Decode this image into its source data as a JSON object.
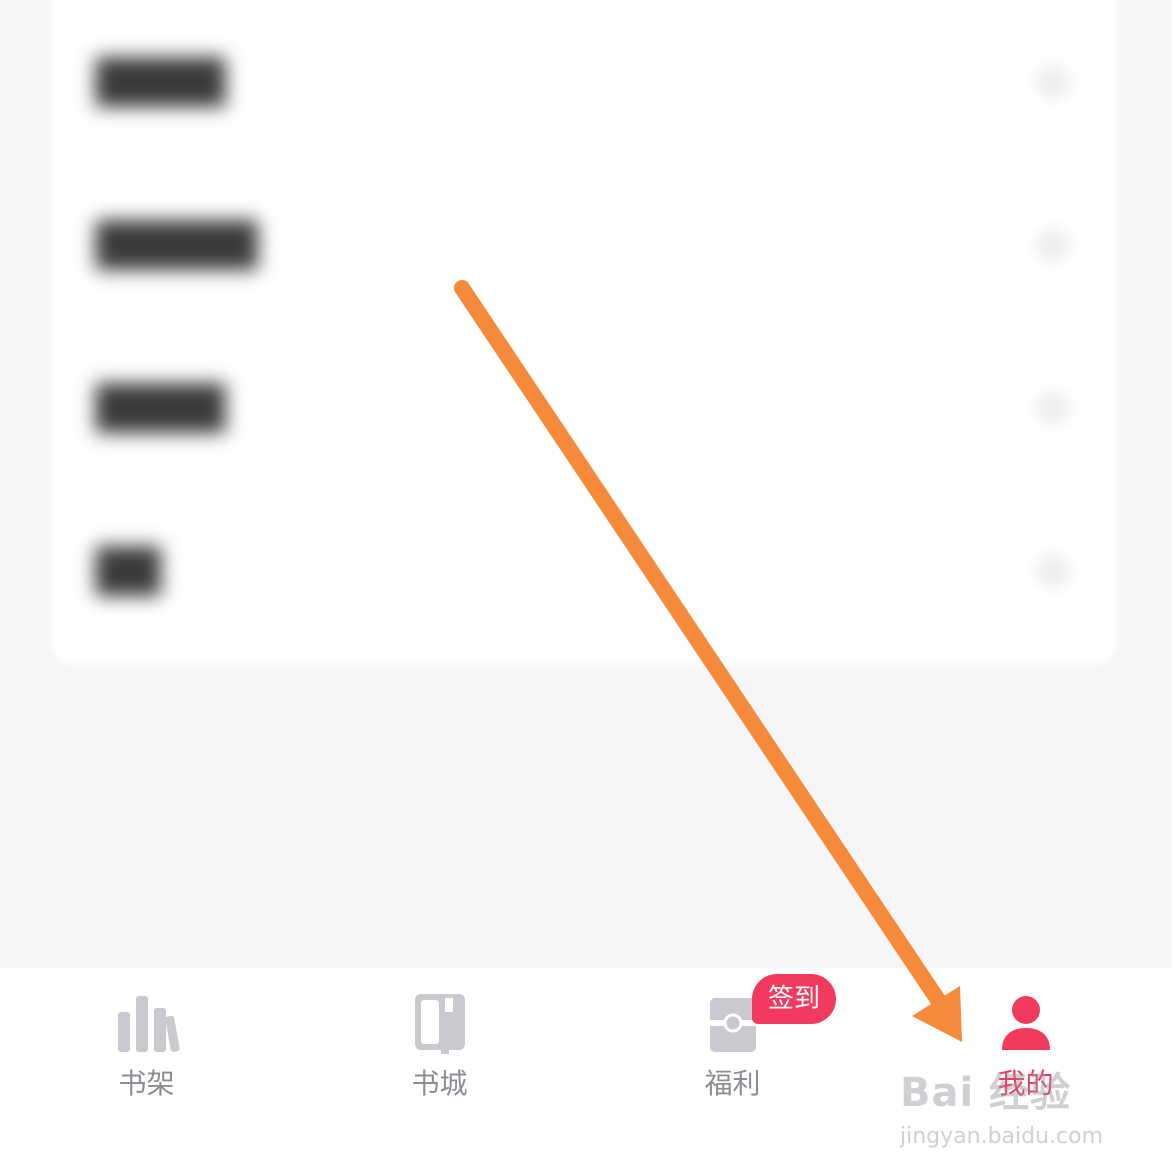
{
  "menu": {
    "items": [
      {
        "label": "████"
      },
      {
        "label": "█████"
      },
      {
        "label": "████"
      },
      {
        "label": "██"
      }
    ]
  },
  "tabs": [
    {
      "label": "书架",
      "icon": "bookshelf-icon"
    },
    {
      "label": "书城",
      "icon": "bookstore-icon"
    },
    {
      "label": "福利",
      "icon": "gift-icon",
      "badge": "签到"
    },
    {
      "label": "我的",
      "icon": "profile-icon",
      "active": true
    }
  ],
  "colors": {
    "accent": "#e83e64",
    "badge": "#f23a5f",
    "arrow": "#f58a3a",
    "icon_gray": "#c9c9d0"
  },
  "watermark": {
    "brand": "Bai 经验",
    "url": "jingyan.baidu.com"
  }
}
